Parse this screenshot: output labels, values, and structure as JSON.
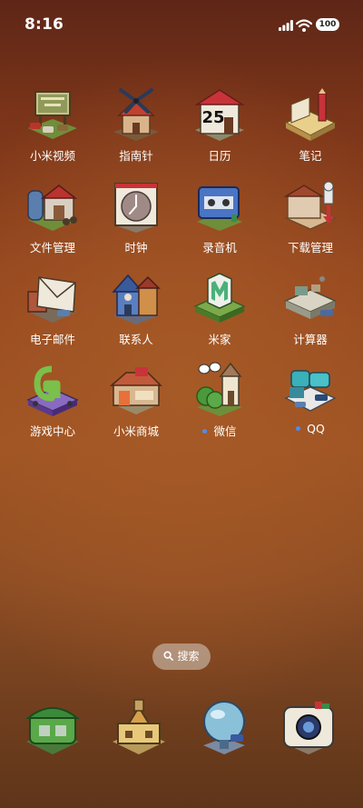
{
  "status_bar": {
    "time": "8:16",
    "battery": "100"
  },
  "apps": [
    {
      "name": "小米视频",
      "icon": "xiaomi-video-icon"
    },
    {
      "name": "指南针",
      "icon": "compass-icon"
    },
    {
      "name": "日历",
      "icon": "calendar-icon",
      "date": "25"
    },
    {
      "name": "笔记",
      "icon": "notes-icon"
    },
    {
      "name": "文件管理",
      "icon": "file-manager-icon"
    },
    {
      "name": "时钟",
      "icon": "clock-icon"
    },
    {
      "name": "录音机",
      "icon": "recorder-icon"
    },
    {
      "name": "下载管理",
      "icon": "download-manager-icon"
    },
    {
      "name": "电子邮件",
      "icon": "email-icon"
    },
    {
      "name": "联系人",
      "icon": "contacts-icon"
    },
    {
      "name": "米家",
      "icon": "mi-home-icon"
    },
    {
      "name": "计算器",
      "icon": "calculator-icon"
    },
    {
      "name": "游戏中心",
      "icon": "game-center-icon"
    },
    {
      "name": "小米商城",
      "icon": "mi-store-icon"
    },
    {
      "name": "微信",
      "icon": "wechat-icon",
      "badge_dot": true
    },
    {
      "name": "QQ",
      "icon": "qq-icon",
      "badge_dot": true
    }
  ],
  "search": {
    "label": "搜索"
  },
  "dock": [
    {
      "icon": "phone-icon"
    },
    {
      "icon": "messages-icon"
    },
    {
      "icon": "browser-icon"
    },
    {
      "icon": "camera-icon"
    }
  ],
  "colors": {
    "accent_dot": "#4b8df5",
    "background_top": "#5e2617",
    "background_mid": "#a05424"
  }
}
